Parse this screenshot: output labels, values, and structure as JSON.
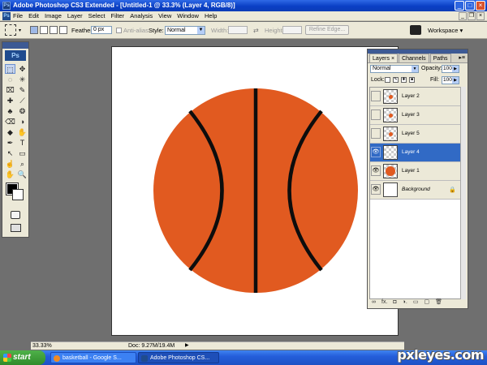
{
  "window": {
    "title": "Adobe Photoshop CS3 Extended - [Untitled-1 @ 33.3% (Layer 4, RGB/8)]",
    "app_logo": "Ps",
    "controls": {
      "minimize": "_",
      "maximize": "□",
      "close": "×"
    }
  },
  "menubar": {
    "logo": "Ps",
    "items": [
      "File",
      "Edit",
      "Image",
      "Layer",
      "Select",
      "Filter",
      "Analysis",
      "View",
      "Window",
      "Help"
    ],
    "doc_controls": {
      "minimize": "_",
      "restore": "❐",
      "close": "×"
    }
  },
  "options_bar": {
    "tool_icon": "rectangular-marquee-icon",
    "feather_label": "Feather:",
    "feather_value": "0 px",
    "antialias_label": "Anti-alias",
    "style_label": "Style:",
    "style_value": "Normal",
    "width_label": "Width:",
    "height_label": "Height:",
    "refine_edge_label": "Refine Edge...",
    "workspace_label": "Workspace ▾"
  },
  "toolbox": {
    "logo": "Ps",
    "tools": [
      "⬚",
      "✥",
      "◌",
      "✳",
      "⌧",
      "✎",
      "✚",
      "⟋",
      "♣",
      "❂",
      "⌫",
      "◑",
      "◆",
      "✋",
      "✒",
      "T",
      "↖",
      "▭",
      "☝",
      "⌕",
      "✋",
      "🔍"
    ],
    "foreground_color": "#000000",
    "background_color": "#ffffff"
  },
  "canvas": {
    "ball_color": "#e15a20",
    "seam_color": "#0d0d0d",
    "background": "#ffffff"
  },
  "statusbar": {
    "zoom": "33.33%",
    "doc_size": "Doc: 9.27M/19.4M",
    "arrow": "▶"
  },
  "layers_panel": {
    "tabs": [
      "Layers",
      "Channels",
      "Paths"
    ],
    "active_tab": "Layers",
    "tab_close": "×",
    "menu_icon": "▸≡",
    "blend_mode": "Normal",
    "opacity_label": "Opacity:",
    "opacity_value": "100%",
    "lock_label": "Lock:",
    "fill_label": "Fill:",
    "fill_value": "100%",
    "layers": [
      {
        "name": "Layer 2",
        "visible": false,
        "selected": false,
        "thumb": "dot"
      },
      {
        "name": "Layer 3",
        "visible": false,
        "selected": false,
        "thumb": "dot"
      },
      {
        "name": "Layer 5",
        "visible": false,
        "selected": false,
        "thumb": "dot"
      },
      {
        "name": "Layer 4",
        "visible": true,
        "selected": true,
        "thumb": "blank"
      },
      {
        "name": "Layer 1",
        "visible": true,
        "selected": false,
        "thumb": "ball"
      },
      {
        "name": "Background",
        "visible": true,
        "selected": false,
        "thumb": "white",
        "locked": true
      }
    ],
    "eye_glyph": "👁",
    "lock_glyph": "🔒",
    "bottom_icons": [
      "∞",
      "fx.",
      "◘",
      "◑.",
      "▭",
      "▢",
      "🗑"
    ]
  },
  "taskbar": {
    "start_label": "start",
    "tasks": [
      "basketball - Google S...",
      "Adobe Photoshop CS..."
    ]
  },
  "watermark": "pxleyes.com"
}
